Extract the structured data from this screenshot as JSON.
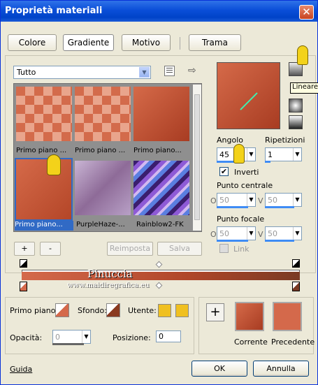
{
  "window": {
    "title": "Proprietà materiali",
    "close": "✕"
  },
  "tabs": [
    {
      "label": "Colore"
    },
    {
      "label": "Gradiente"
    },
    {
      "label": "Motivo"
    },
    {
      "label": "Trama"
    }
  ],
  "category": {
    "value": "Tutto"
  },
  "gallery": {
    "items": [
      {
        "label": "Primo piano ..."
      },
      {
        "label": "Primo piano ..."
      },
      {
        "label": "Primo piano..."
      },
      {
        "label": "Primo piano..."
      },
      {
        "label": "PurpleHaze-..."
      },
      {
        "label": "Rainblow2-FK"
      }
    ]
  },
  "style_tooltip": "Lineare",
  "angle": {
    "label": "Angolo",
    "value": "45"
  },
  "repeats": {
    "label": "Ripetizioni",
    "value": "1"
  },
  "invert": {
    "label": "Inverti"
  },
  "center_point": {
    "label": "Punto centrale",
    "x_label": "O",
    "x": "50",
    "y_label": "V",
    "y": "50"
  },
  "focal_point": {
    "label": "Punto focale",
    "x_label": "O",
    "x": "50",
    "y_label": "V",
    "y": "50"
  },
  "link": {
    "label": "Link"
  },
  "gallery_buttons": {
    "add": "+",
    "remove": "-",
    "reset": "Reimposta",
    "save": "Salva"
  },
  "watermark": {
    "line1": "Pinuccia",
    "line2": "www.maidiregrafica.eu"
  },
  "bottom": {
    "foreground_label": "Primo piano:",
    "background_label": "Sfondo:",
    "user_label": "Utente:",
    "opacity_label": "Opacità:",
    "opacity_value": "0",
    "position_label": "Posizione:",
    "position_value": "0",
    "add": "+",
    "current_label": "Corrente",
    "previous_label": "Precedente"
  },
  "footer": {
    "help": "Guida",
    "ok": "OK",
    "cancel": "Annulla"
  },
  "colors": {
    "rust": "#c24f2a",
    "coral": "#d6694c",
    "accent": "#316ac5"
  }
}
